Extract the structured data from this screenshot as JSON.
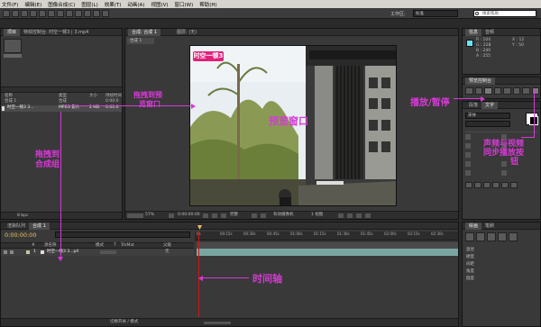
{
  "menu": [
    "文件(F)",
    "编辑(E)",
    "图像合成(C)",
    "图层(L)",
    "效果(T)",
    "动画(A)",
    "视图(V)",
    "窗口(W)",
    "帮助(H)"
  ],
  "toolbar": {
    "workspace_label": "工作区:",
    "workspace_value": "标准",
    "search_placeholder": "搜索帮助"
  },
  "project_panel": {
    "tabs": [
      "项目",
      "特效控制台: 时空一顿3 | 3.mp4"
    ],
    "columns": [
      "名称",
      "类型",
      "大小",
      "持续时间"
    ],
    "items": [
      {
        "name": "合成 1",
        "type": "合成",
        "size": "",
        "duration": "0:00:0"
      },
      {
        "name": "时空一顿3 3...",
        "type": "MPEG 影片",
        "size": "2 MB",
        "duration": "0:00:0"
      }
    ],
    "footer_depth": "8 bpc"
  },
  "composition_panel": {
    "tab_label": "合成: 合成 1",
    "layer_tab": "图层: (无)",
    "sub_tab": "合成 1",
    "footer": {
      "zoom": "57%",
      "timecode": "0:00:00:00",
      "resolution": "完整",
      "camera": "有效摄像机",
      "views": "1 视图"
    },
    "video_logo": "时空一顿3"
  },
  "info_panel": {
    "tabs": [
      "信息",
      "音频"
    ],
    "values": {
      "r": "R : 104",
      "g": "G : 228",
      "b": "B : 240",
      "a": "A : 255",
      "x": "X : 12",
      "y": "Y : 50"
    }
  },
  "preview_panel": {
    "tab_label": "预览控制台"
  },
  "character_panel": {
    "tabs": [
      "段落",
      "文字"
    ],
    "font_label": "宋体"
  },
  "timeline_panel": {
    "tabs": [
      "渲染队列",
      "合成 1"
    ],
    "timecode": "0:00:00:00",
    "header_columns": [
      "#",
      "源名称",
      "模式",
      "T",
      "TrkMat",
      "父级"
    ],
    "layer": {
      "index": "1",
      "name": "时空一顿3 3...p4",
      "parent": "无"
    },
    "ruler_ticks": [
      "00:15s",
      "00:30s",
      "00:45s",
      "01:00s",
      "01:15s",
      "01:30s",
      "01:45s",
      "02:00s",
      "02:15s",
      "02:30s",
      "02:45s"
    ],
    "footer_label": "切换开关 / 模式"
  },
  "bottom_right_panel": {
    "tabs": [
      "绘画",
      "笔刷"
    ],
    "values": [
      "直径",
      "硬度",
      "间距",
      "角度",
      "圆度"
    ]
  },
  "annotations": {
    "drag_to_preview_line1": "拖拽到预",
    "drag_to_preview_line2": "览窗口",
    "preview_window": "预览窗口",
    "play_pause": "播放/暂停",
    "av_sync_line1": "声频与视频",
    "av_sync_line2": "同步播放按",
    "av_sync_line3": "钮",
    "drag_to_comp_line1": "拖拽到",
    "drag_to_comp_line2": "合成组",
    "timeline": "时间轴"
  }
}
